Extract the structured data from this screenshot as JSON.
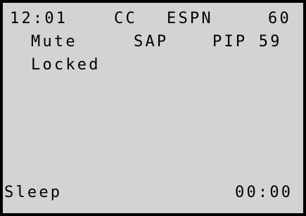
{
  "status_row": {
    "time": "12:01",
    "cc": "CC",
    "channel_name": "ESPN",
    "channel_number": "60"
  },
  "audio_row": {
    "mute": "Mute",
    "sap": "SAP",
    "pip": "PIP 59"
  },
  "lock_row": {
    "locked": "Locked"
  },
  "sleep_row": {
    "label": "Sleep",
    "timer": "00:00"
  },
  "colors": {
    "screen_background": "#d3d3d3",
    "text": "#000000",
    "border": "#000000"
  }
}
